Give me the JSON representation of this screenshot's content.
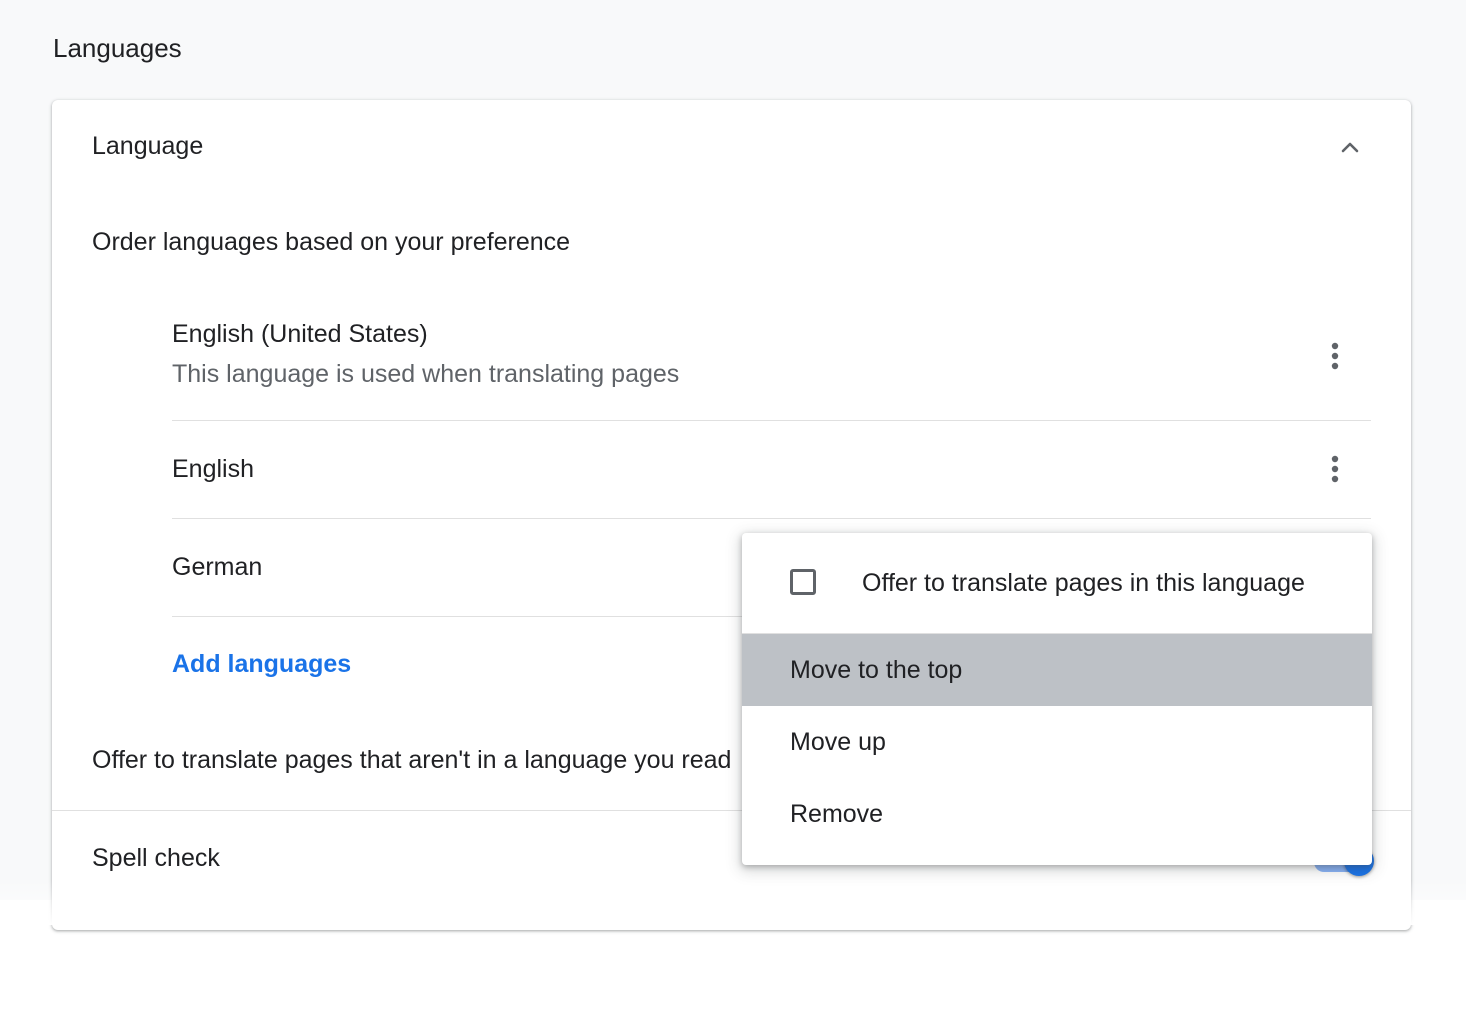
{
  "page": {
    "section_title": "Languages"
  },
  "language_card": {
    "header": "Language",
    "collapse_icon": "chevron-up-icon",
    "order_label": "Order languages based on your preference",
    "languages": [
      {
        "name": "English (United States)",
        "subtitle": "This language is used when translating pages"
      },
      {
        "name": "English",
        "subtitle": ""
      },
      {
        "name": "German",
        "subtitle": ""
      }
    ],
    "more_icon": "more-vert-icon",
    "add_languages_label": "Add languages",
    "offer_translate_label": "Offer to translate pages that aren't in a language you read",
    "offer_translate_enabled": true
  },
  "spell_check": {
    "label": "Spell check",
    "enabled": true
  },
  "context_menu": {
    "offer_translate_label": "Offer to translate pages in this language",
    "offer_translate_checked": false,
    "items": [
      {
        "label": "Move to the top",
        "highlighted": true
      },
      {
        "label": "Move up",
        "highlighted": false
      },
      {
        "label": "Remove",
        "highlighted": false
      }
    ]
  },
  "colors": {
    "accent": "#1a73e8",
    "page_background": "#f8f9fa",
    "menu_highlight": "#bdc1c6",
    "secondary_text": "#5f6368"
  }
}
